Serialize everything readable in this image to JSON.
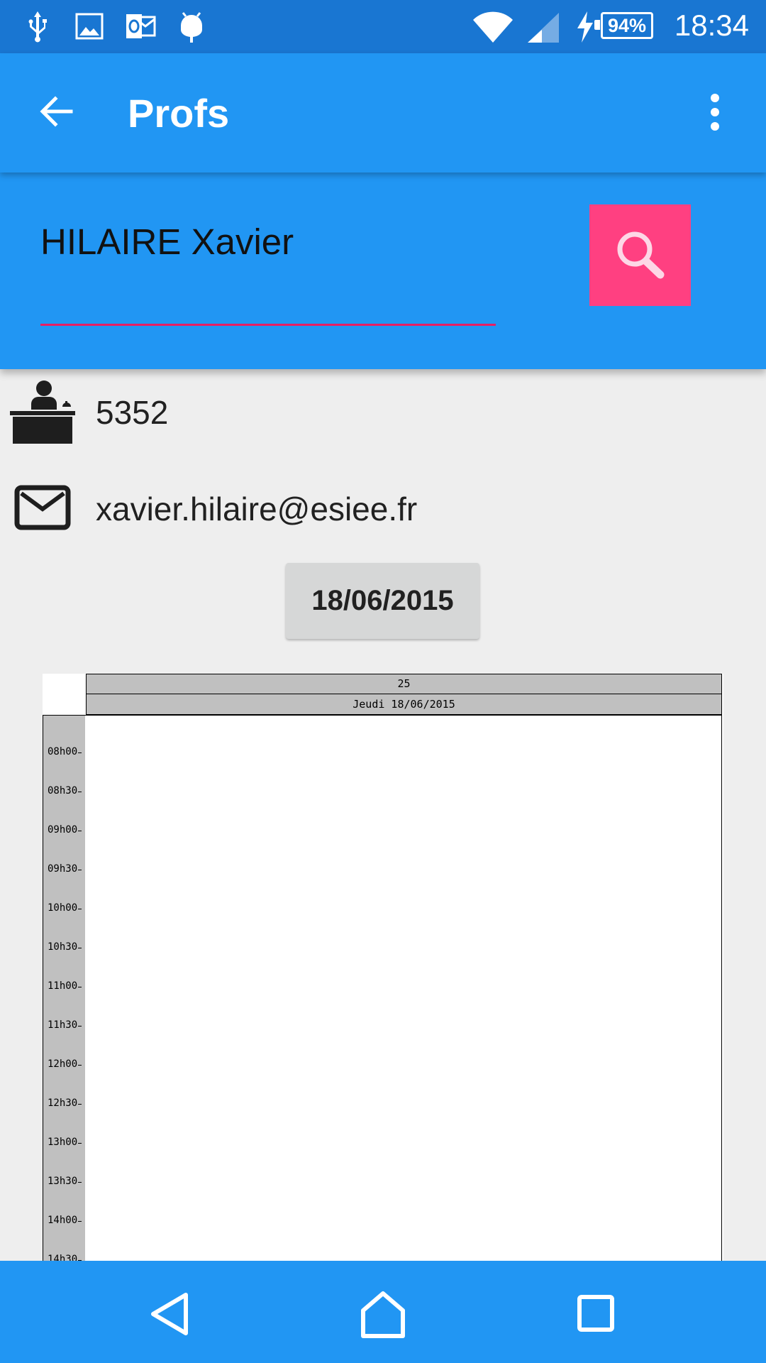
{
  "status_bar": {
    "left_icons": [
      "usb-icon",
      "image-icon",
      "outlook-icon",
      "android-icon"
    ],
    "right_icons": [
      "wifi-icon",
      "signal-icon",
      "charging-icon"
    ],
    "battery": "94%",
    "time": "18:34"
  },
  "app_bar": {
    "title": "Profs",
    "back_icon": "arrow-back-icon",
    "menu_icon": "more-vert-icon",
    "color": "#2196f3"
  },
  "search": {
    "value": "HILAIRE Xavier",
    "button_icon": "search-icon",
    "button_color": "#ff4081",
    "underline_color": "#e91e63"
  },
  "info": {
    "office_icon": "desk-icon",
    "office": "5352",
    "email_icon": "mail-icon",
    "email": "xavier.hilaire@esiee.fr"
  },
  "date_button": "18/06/2015",
  "schedule": {
    "week": "25",
    "day": "Jeudi 18/06/2015",
    "times": [
      "08h00",
      "08h30",
      "09h00",
      "09h30",
      "10h00",
      "10h30",
      "11h00",
      "11h30",
      "12h00",
      "12h30",
      "13h00",
      "13h30",
      "14h00",
      "14h30"
    ]
  },
  "nav_bar": {
    "icons": [
      "back-triangle-icon",
      "home-icon",
      "recents-icon"
    ]
  }
}
